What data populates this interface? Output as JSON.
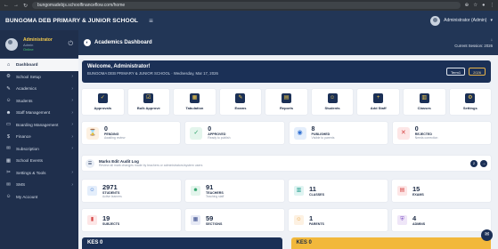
{
  "browser": {
    "url": "bungomadebjs.schoolfinanceflow.com/home"
  },
  "topbar": {
    "title": "BUNGOMA DEB PRIMARY & JUNIOR SCHOOL",
    "admin_label": "Administrator (Admin)"
  },
  "profile": {
    "name": "Administrator",
    "role": "Admin",
    "status": "Online"
  },
  "sidebar": {
    "items": [
      {
        "label": "Dashboard",
        "icon": "home-icon",
        "glyph": "⌂",
        "active": true,
        "chev": false
      },
      {
        "label": "School Setup",
        "icon": "gear-icon",
        "glyph": "⚙",
        "active": false,
        "chev": true
      },
      {
        "label": "Academics",
        "icon": "graduation-cap-icon",
        "glyph": "✎",
        "active": false,
        "chev": true
      },
      {
        "label": "Students",
        "icon": "students-icon",
        "glyph": "☺",
        "active": false,
        "chev": true
      },
      {
        "label": "Staff Management",
        "icon": "staff-icon",
        "glyph": "☻",
        "active": false,
        "chev": true
      },
      {
        "label": "Boarding Management",
        "icon": "bed-icon",
        "glyph": "▭",
        "active": false,
        "chev": true
      },
      {
        "label": "Finance",
        "icon": "money-icon",
        "glyph": "$",
        "active": false,
        "chev": true
      },
      {
        "label": "Subscription",
        "icon": "subscription-icon",
        "glyph": "✉",
        "active": false,
        "chev": true
      },
      {
        "label": "School Events",
        "icon": "calendar-icon",
        "glyph": "▦",
        "active": false,
        "chev": false
      },
      {
        "label": "Settings & Tools",
        "icon": "tools-icon",
        "glyph": "✂",
        "active": false,
        "chev": true
      },
      {
        "label": "SMS",
        "icon": "chat-icon",
        "glyph": "✉",
        "active": false,
        "chev": true
      },
      {
        "label": "My Account",
        "icon": "user-icon",
        "glyph": "☺",
        "active": false,
        "chev": false
      }
    ]
  },
  "pagehead": {
    "title": "Academics Dashboard",
    "session_label": "Current Session: 2026"
  },
  "welcome": {
    "title": "Welcome, Administrator!",
    "subtitle": "BUNGOMA DEB PRIMARY & JUNIOR SCHOOL · Wednesday, Mar 17, 2026",
    "term_btn": "Term1",
    "year_btn": "2026"
  },
  "quick_actions": [
    {
      "label": "Approvals",
      "icon": "approvals-icon",
      "glyph": "✓"
    },
    {
      "label": "Bulk Approve",
      "icon": "bulk-approve-icon",
      "glyph": "☑"
    },
    {
      "label": "Tabulation",
      "icon": "tabulation-icon",
      "glyph": "▦"
    },
    {
      "label": "Exams",
      "icon": "exams-icon",
      "glyph": "✎"
    },
    {
      "label": "Reports",
      "icon": "reports-icon",
      "glyph": "▤"
    },
    {
      "label": "Students",
      "icon": "students-icon",
      "glyph": "☺"
    },
    {
      "label": "Add Staff",
      "icon": "add-staff-icon",
      "glyph": "+"
    },
    {
      "label": "Classes",
      "icon": "classes-icon",
      "glyph": "▥"
    },
    {
      "label": "Settings",
      "icon": "settings-icon",
      "glyph": "⚙"
    }
  ],
  "status_cards": [
    {
      "count": "0",
      "label": "PENDING",
      "sub": "Awaiting review",
      "icon": "hourglass-icon",
      "glyph": "⌛",
      "bg": "#fdf1e2",
      "fg": "#e8a13a"
    },
    {
      "count": "0",
      "label": "APPROVED",
      "sub": "Ready to publish",
      "icon": "check-icon",
      "glyph": "✓",
      "bg": "#e3f5ec",
      "fg": "#2fa36b"
    },
    {
      "count": "8",
      "label": "PUBLISHED",
      "sub": "Visible to parents",
      "icon": "globe-icon",
      "glyph": "◉",
      "bg": "#e4eefb",
      "fg": "#2f6fd1"
    },
    {
      "count": "0",
      "label": "REJECTED",
      "sub": "Needs correction",
      "icon": "x-icon",
      "glyph": "✕",
      "bg": "#fde6e6",
      "fg": "#d64545"
    }
  ],
  "audit": {
    "title": "Marks Edit Audit Log",
    "subtitle": "Review all mark changes made by teachers or administrators/system users",
    "count": "2"
  },
  "stats_row1": [
    {
      "count": "2971",
      "label": "STUDENTS",
      "sub": "Active learners",
      "icon": "students-icon",
      "glyph": "☺",
      "bg": "#e4eefb",
      "fg": "#2f6fd1"
    },
    {
      "count": "91",
      "label": "TEACHERS",
      "sub": "Teaching staff",
      "icon": "teacher-icon",
      "glyph": "☻",
      "bg": "#e3f5ec",
      "fg": "#2fa36b"
    },
    {
      "count": "11",
      "label": "CLASSES",
      "sub": "",
      "icon": "classes-icon",
      "glyph": "▥",
      "bg": "#e0f4f2",
      "fg": "#1f9a8a"
    },
    {
      "count": "15",
      "label": "EXAMS",
      "sub": "",
      "icon": "exams-icon",
      "glyph": "▤",
      "bg": "#fde6e6",
      "fg": "#d64545"
    }
  ],
  "stats_row2": [
    {
      "count": "19",
      "label": "SUBJECTS",
      "sub": "",
      "icon": "subjects-icon",
      "glyph": "▮",
      "bg": "#fde6e6",
      "fg": "#d64545"
    },
    {
      "count": "59",
      "label": "SECTIONS",
      "sub": "",
      "icon": "sections-icon",
      "glyph": "▦",
      "bg": "#e6e9f5",
      "fg": "#3d4f8f"
    },
    {
      "count": "1",
      "label": "PARENTS",
      "sub": "",
      "icon": "parents-icon",
      "glyph": "☺",
      "bg": "#fdf1e2",
      "fg": "#e8a13a"
    },
    {
      "count": "4",
      "label": "ADMINS",
      "sub": "",
      "icon": "shield-icon",
      "glyph": "⛨",
      "bg": "#efe6f8",
      "fg": "#7d4ec2"
    }
  ],
  "finance": [
    {
      "label": "KES 0",
      "style": "dark"
    },
    {
      "label": "KES 0",
      "style": "gold"
    }
  ]
}
